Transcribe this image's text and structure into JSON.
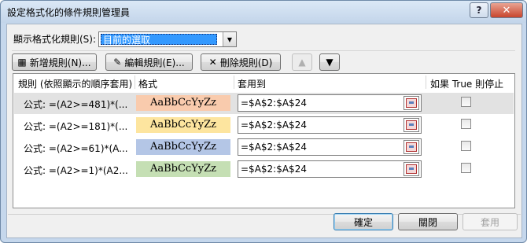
{
  "window": {
    "title": "設定格式化的條件規則管理員",
    "help_glyph": "?",
    "close_glyph": "✕"
  },
  "show_rules": {
    "label": "顯示格式化規則(S):",
    "selected": "目前的選取"
  },
  "toolbar": {
    "new_rule": "新增規則(N)...",
    "edit_rule": "編輯規則(E)...",
    "delete_rule": "刪除規則(D)",
    "up_glyph": "▲",
    "down_glyph": "▼"
  },
  "table": {
    "headers": [
      "規則 (依照顯示的順序套用)",
      "格式",
      "套用到",
      "如果 True 則停止"
    ],
    "rows": [
      {
        "rule": "公式: =(A2>=481)*(...",
        "preview": "AaBbCcYyZz",
        "color": "#f9cbad",
        "applies_to": "=$A$2:$A$24",
        "stop": false,
        "selected": true
      },
      {
        "rule": "公式: =(A2>=181)*(...",
        "preview": "AaBbCcYyZz",
        "color": "#fde59f",
        "applies_to": "=$A$2:$A$24",
        "stop": false,
        "selected": false
      },
      {
        "rule": "公式: =(A2>=61)*(A...",
        "preview": "AaBbCcYyZz",
        "color": "#b4c6e6",
        "applies_to": "=$A$2:$A$24",
        "stop": false,
        "selected": false
      },
      {
        "rule": "公式: =(A2>=1)*(A2...",
        "preview": "AaBbCcYyZz",
        "color": "#c5dfb4",
        "applies_to": "=$A$2:$A$24",
        "stop": false,
        "selected": false
      }
    ]
  },
  "footer": {
    "ok": "確定",
    "close": "關閉",
    "apply": "套用"
  }
}
